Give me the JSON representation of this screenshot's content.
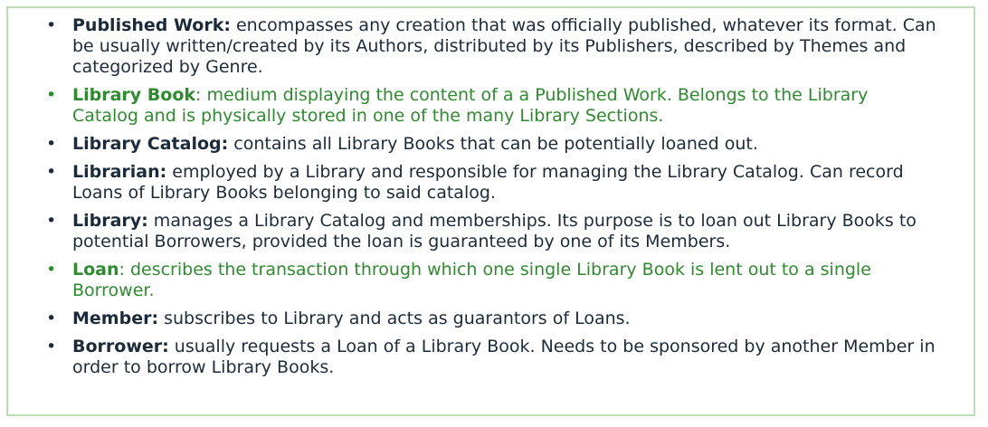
{
  "entries": [
    {
      "term": "Published Work:",
      "definition": " encompasses any creation that was officially published, whatever its format. Can be usually written/created by its Authors, distributed by its Publishers, described by Themes and categorized by Genre.",
      "highlight": false
    },
    {
      "term": "Library Book",
      "definition": ": medium displaying the content of a a Published Work. Belongs to the Library Catalog and is physically stored in one of the many Library Sections.",
      "highlight": true
    },
    {
      "term": "Library Catalog:",
      "definition": " contains all Library Books that can be potentially loaned out.",
      "highlight": false
    },
    {
      "term": "Librarian:",
      "definition": " employed by a Library and responsible for managing the Library Catalog. Can record Loans of Library Books belonging to said catalog.",
      "highlight": false
    },
    {
      "term": "Library:",
      "definition": " manages a Library Catalog and memberships. Its purpose is to loan out Library Books to potential Borrowers, provided the loan is guaranteed by one of its Members.",
      "highlight": false
    },
    {
      "term": "Loan",
      "definition": ": describes the transaction through which one single Library Book is lent out to a single Borrower.",
      "highlight": true
    },
    {
      "term": "Member:",
      "definition": " subscribes to Library and acts as guarantors of Loans.",
      "highlight": false
    },
    {
      "term": "Borrower:",
      "definition": " usually requests a Loan of a Library Book. Needs to be sponsored by another Member in order to borrow Library Books.",
      "highlight": false
    }
  ],
  "colors": {
    "text": "#1c2b3b",
    "highlight": "#2e8b2e",
    "border": "#b9dfb2"
  },
  "bullet_glyph": "•"
}
